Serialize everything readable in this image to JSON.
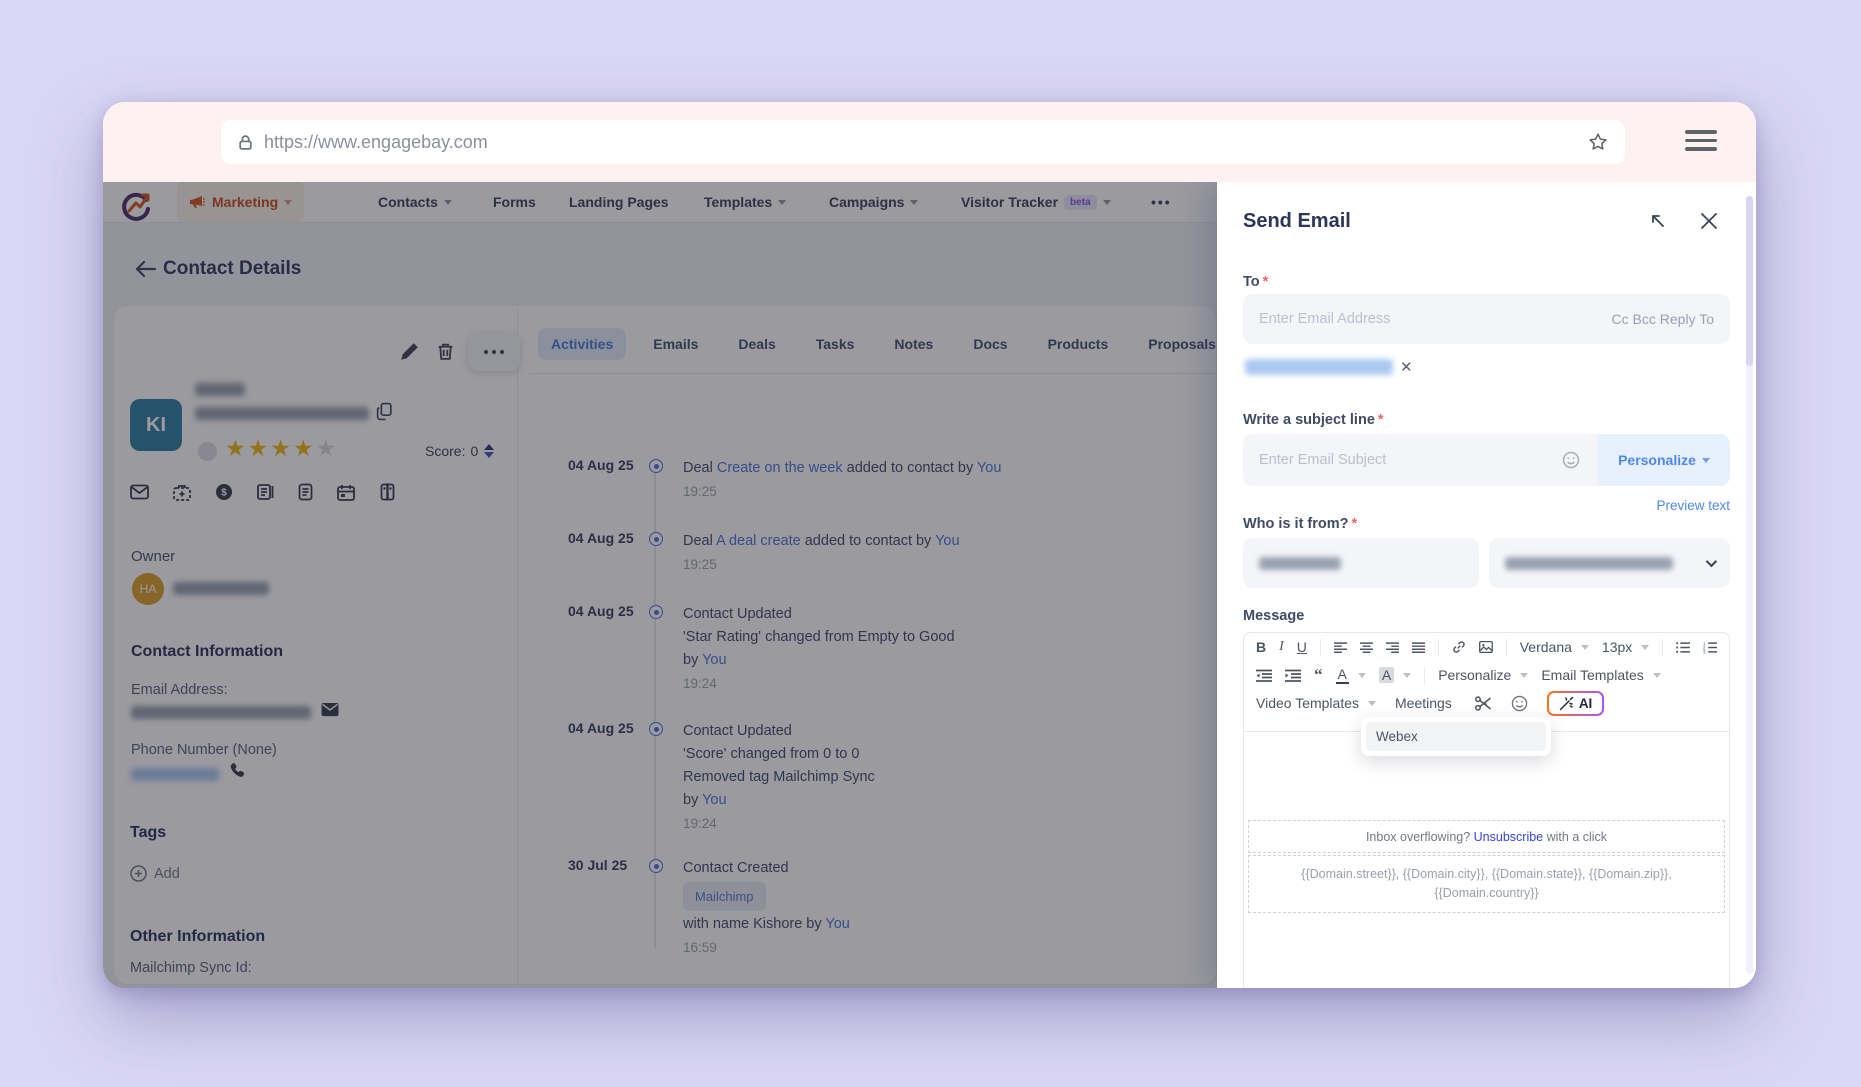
{
  "browser": {
    "url": "https://www.engagebay.com"
  },
  "nav": {
    "brand": {
      "label": "Marketing"
    },
    "items": [
      {
        "label": "Contacts"
      },
      {
        "label": "Forms"
      },
      {
        "label": "Landing Pages"
      },
      {
        "label": "Templates"
      },
      {
        "label": "Campaigns"
      },
      {
        "label": "Visitor Tracker",
        "beta": "beta"
      }
    ]
  },
  "page": {
    "title": "Contact Details"
  },
  "contact_card": {
    "avatar_initials": "KI",
    "rating": {
      "filled": 4,
      "total": 5
    },
    "score_label": "Score:",
    "score_value": "0",
    "owner_label": "Owner",
    "owner_initials": "HA",
    "contact_info_title": "Contact Information",
    "email_label": "Email Address:",
    "phone_label": "Phone Number (None)",
    "tags_title": "Tags",
    "add_label": "Add",
    "other_info_title": "Other Information",
    "mailchimp_label": "Mailchimp Sync Id:"
  },
  "tabs": [
    {
      "label": "Activities"
    },
    {
      "label": "Emails"
    },
    {
      "label": "Deals"
    },
    {
      "label": "Tasks"
    },
    {
      "label": "Notes"
    },
    {
      "label": "Docs"
    },
    {
      "label": "Products"
    },
    {
      "label": "Proposals"
    }
  ],
  "timeline": {
    "entries": [
      {
        "date": "04 Aug 25",
        "pre": "Deal ",
        "link": "Create on the week",
        "post": " added to contact by ",
        "actor": "You",
        "time": "19:25"
      },
      {
        "date": "04 Aug 25",
        "pre": "Deal ",
        "link": "A deal create",
        "post": " added to contact by ",
        "actor": "You",
        "time": "19:25"
      },
      {
        "date": "04 Aug 25",
        "line1": "Contact Updated",
        "line2": "'Star Rating' changed from Empty to Good",
        "by": "by ",
        "actor": "You",
        "time": "19:24"
      },
      {
        "date": "04 Aug 25",
        "line1": "Contact Updated",
        "line2": "'Score' changed from 0 to 0",
        "line3": "Removed tag Mailchimp Sync",
        "by": "by ",
        "actor": "You",
        "time": "19:24"
      },
      {
        "date": "30 Jul 25",
        "line1": "Contact Created",
        "badge": "Mailchimp",
        "post": "with name Kishore by ",
        "actor": "You",
        "time": "16:59"
      }
    ]
  },
  "send_email": {
    "title": "Send Email",
    "required_mark": "*",
    "to_label": "To",
    "to_placeholder": "Enter Email Address",
    "cc_bcc": "Cc Bcc Reply To",
    "subject_label": "Write a subject line",
    "subject_placeholder": "Enter Email Subject",
    "personalize_button": "Personalize",
    "preview_text_link": "Preview text",
    "from_label": "Who is it from?",
    "message_label": "Message",
    "toolbar": {
      "font_name": "Verdana",
      "font_size": "13px",
      "personalize": "Personalize",
      "email_templates": "Email Templates",
      "video_templates": "Video Templates",
      "meetings": "Meetings",
      "ai_label": "AI"
    },
    "meetings_menu": {
      "webex": "Webex"
    },
    "footer": {
      "unsub_pre": "Inbox overflowing? ",
      "unsub_link": "Unsubscribe",
      "unsub_post": " with a click",
      "domain_line1": "{{Domain.street}}, {{Domain.city}}, {{Domain.state}}, {{Domain.zip}},",
      "domain_line2": "{{Domain.country}}"
    }
  }
}
